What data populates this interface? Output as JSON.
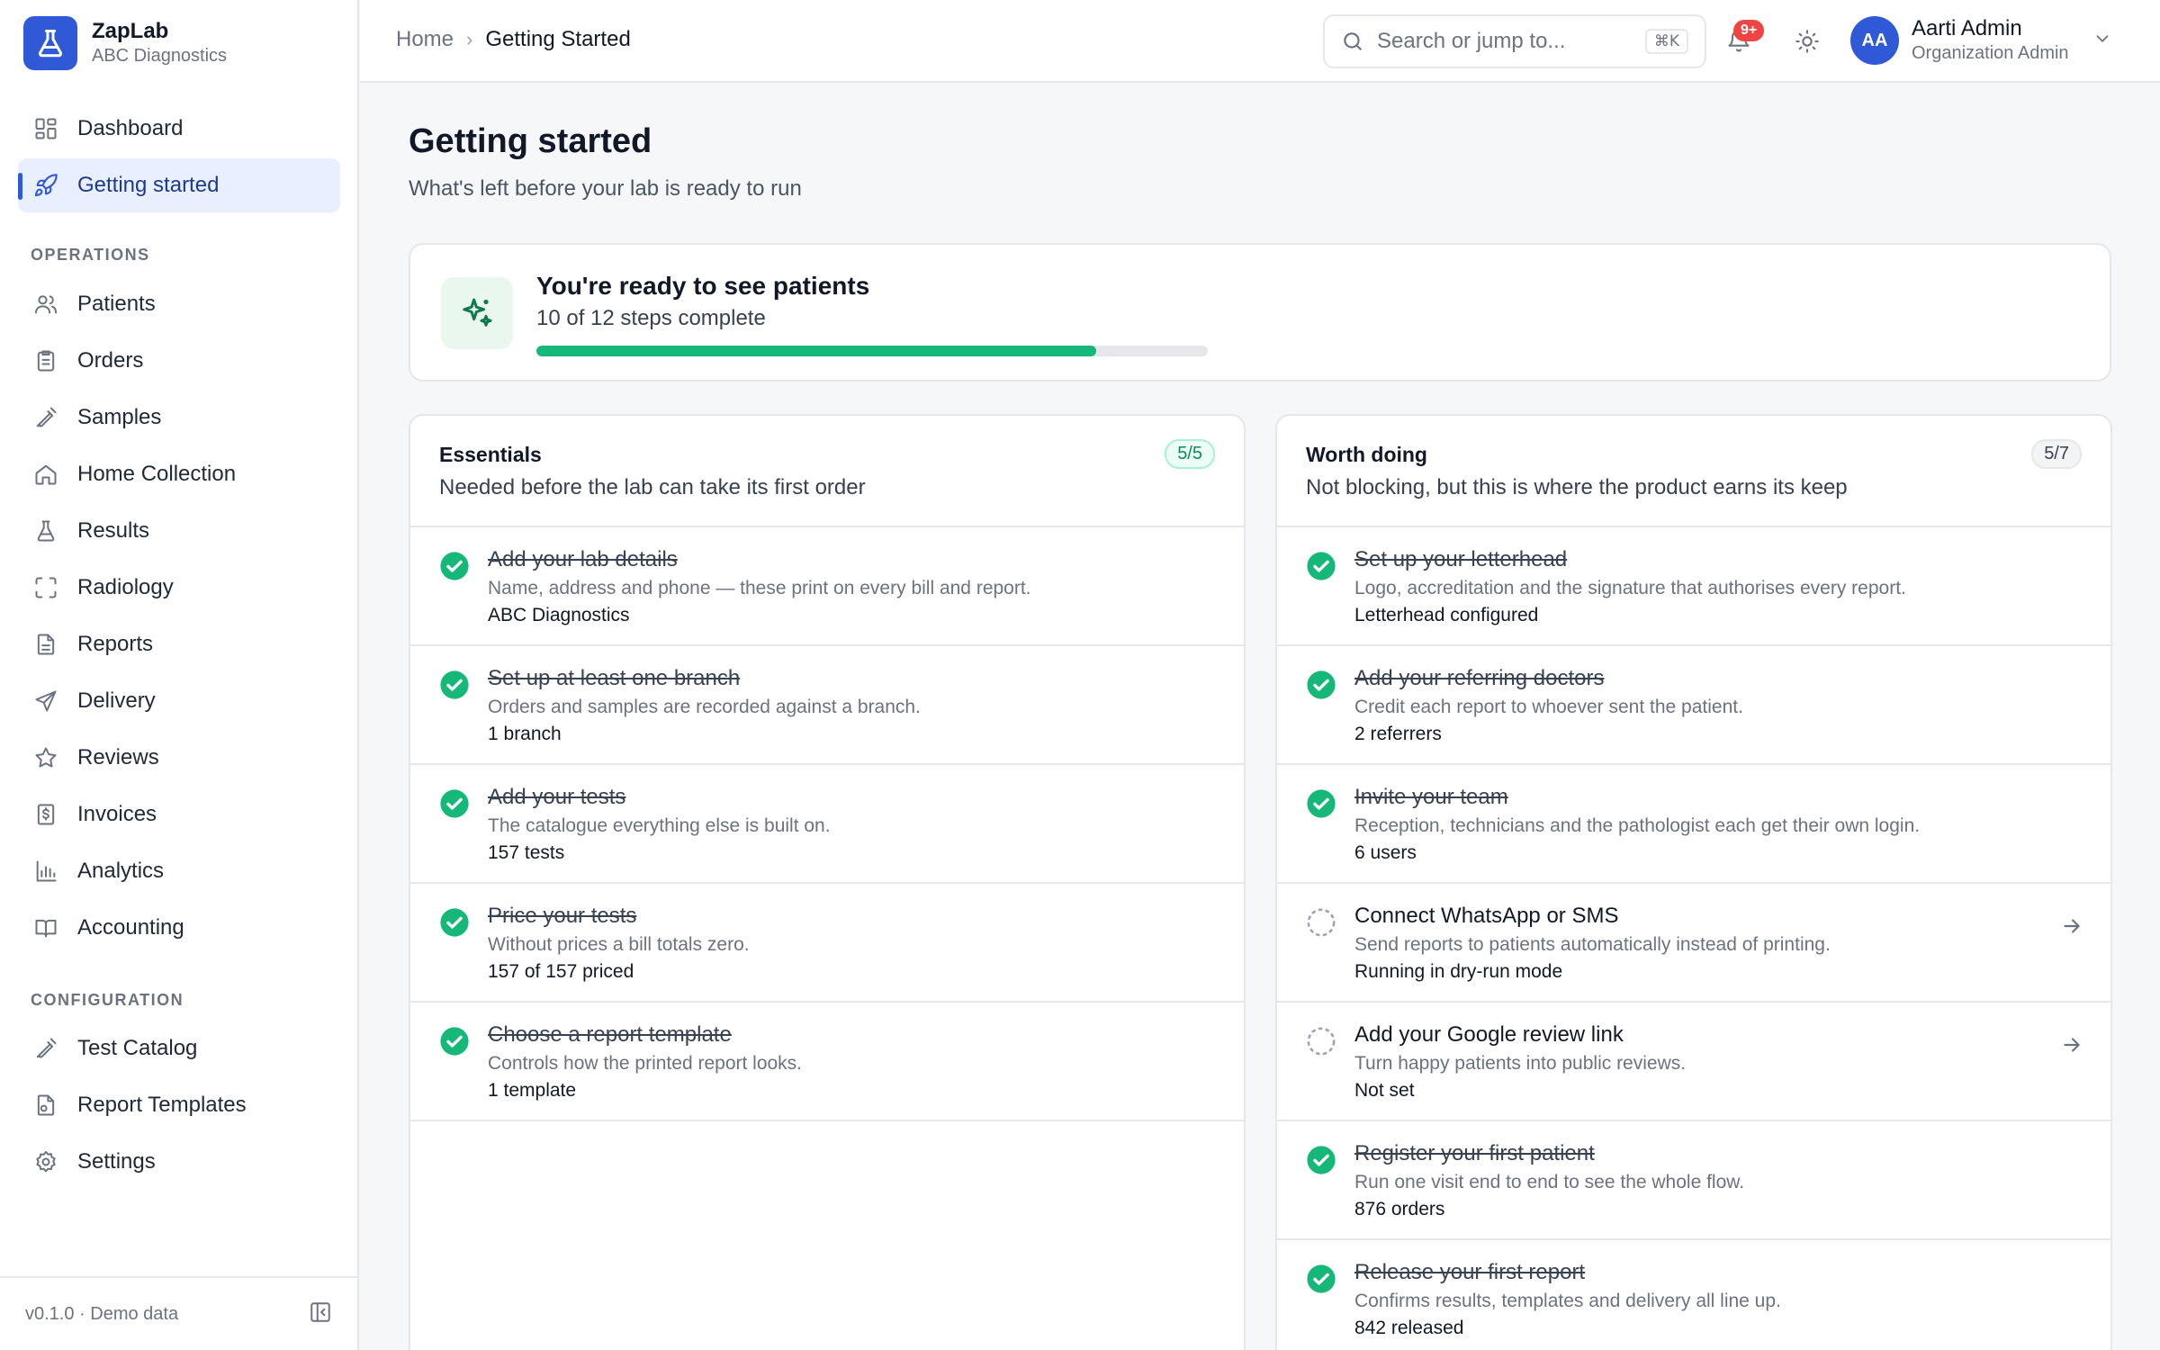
{
  "brand": {
    "name": "ZapLab",
    "org": "ABC Diagnostics"
  },
  "nav": {
    "dashboard": "Dashboard",
    "getting_started": "Getting started",
    "operations_label": "OPERATIONS",
    "operations": [
      "Patients",
      "Orders",
      "Samples",
      "Home Collection",
      "Results",
      "Radiology",
      "Reports",
      "Delivery",
      "Reviews",
      "Invoices",
      "Analytics",
      "Accounting"
    ],
    "configuration_label": "CONFIGURATION",
    "configuration": [
      "Test Catalog",
      "Report Templates",
      "Settings"
    ]
  },
  "footer": {
    "version": "v0.1.0 · Demo data"
  },
  "breadcrumb": {
    "home": "Home",
    "current": "Getting Started"
  },
  "search": {
    "placeholder": "Search or jump to...",
    "shortcut": "⌘K"
  },
  "notifications": {
    "badge": "9+"
  },
  "user": {
    "initials": "AA",
    "name": "Aarti Admin",
    "role": "Organization Admin"
  },
  "page": {
    "title": "Getting started",
    "subtitle": "What's left before your lab is ready to run"
  },
  "progress": {
    "title": "You're ready to see patients",
    "status": "10 of 12 steps complete",
    "completed": 10,
    "total": 12,
    "color": "#16b879"
  },
  "essentials": {
    "title": "Essentials",
    "subtitle": "Needed before the lab can take its first order",
    "count": "5/5",
    "items": [
      {
        "title": "Add your lab details",
        "desc": "Name, address and phone — these print on every bill and report.",
        "meta": "ABC Diagnostics",
        "done": true
      },
      {
        "title": "Set up at least one branch",
        "desc": "Orders and samples are recorded against a branch.",
        "meta": "1 branch",
        "done": true
      },
      {
        "title": "Add your tests",
        "desc": "The catalogue everything else is built on.",
        "meta": "157 tests",
        "done": true
      },
      {
        "title": "Price your tests",
        "desc": "Without prices a bill totals zero.",
        "meta": "157 of 157 priced",
        "done": true
      },
      {
        "title": "Choose a report template",
        "desc": "Controls how the printed report looks.",
        "meta": "1 template",
        "done": true
      }
    ]
  },
  "worth_doing": {
    "title": "Worth doing",
    "subtitle": "Not blocking, but this is where the product earns its keep",
    "count": "5/7",
    "items": [
      {
        "title": "Set up your letterhead",
        "desc": "Logo, accreditation and the signature that authorises every report.",
        "meta": "Letterhead configured",
        "done": true
      },
      {
        "title": "Add your referring doctors",
        "desc": "Credit each report to whoever sent the patient.",
        "meta": "2 referrers",
        "done": true
      },
      {
        "title": "Invite your team",
        "desc": "Reception, technicians and the pathologist each get their own login.",
        "meta": "6 users",
        "done": true
      },
      {
        "title": "Connect WhatsApp or SMS",
        "desc": "Send reports to patients automatically instead of printing.",
        "meta": "Running in dry-run mode",
        "done": false
      },
      {
        "title": "Add your Google review link",
        "desc": "Turn happy patients into public reviews.",
        "meta": "Not set",
        "done": false
      },
      {
        "title": "Register your first patient",
        "desc": "Run one visit end to end to see the whole flow.",
        "meta": "876 orders",
        "done": true
      },
      {
        "title": "Release your first report",
        "desc": "Confirms results, templates and delivery all line up.",
        "meta": "842 released",
        "done": true
      }
    ]
  },
  "colors": {
    "accent": "#2f59d6",
    "success": "#16b879",
    "badge": "#ef4444"
  }
}
